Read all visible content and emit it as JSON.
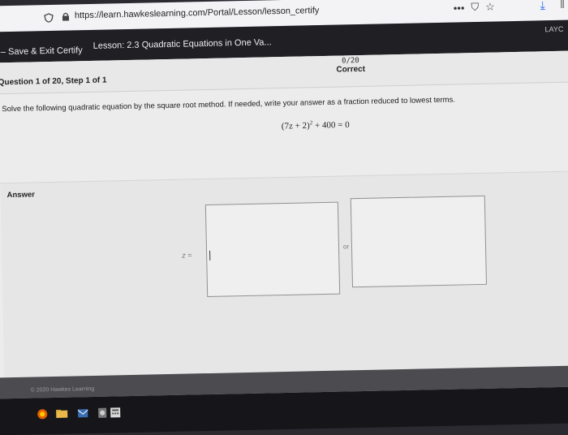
{
  "browser": {
    "url": "https://learn.hawkeslearning.com/Portal/Lesson/lesson_certify",
    "more_icon": "more-icon",
    "pocket_icon": "pocket-icon",
    "star_icon": "star-icon",
    "download_icon": "download-icon",
    "library_icon": "library-icon"
  },
  "lesson_bar": {
    "save_exit": "Save & Exit Certify",
    "lesson_title": "Lesson: 2.3 Quadratic Equations in One Va...",
    "layout_partial": "LAYC"
  },
  "question": {
    "step_label": "Question 1 of 20, Step 1 of 1",
    "score": "0/20",
    "status": "Correct",
    "instructions": "Solve the following quadratic equation by the square root method. If needed, write your answer as a fraction reduced to lowest terms.",
    "equation_left": "(7z + 2)",
    "equation_exp": "2",
    "equation_right": " + 400 = 0"
  },
  "answer": {
    "label": "Answer",
    "var_label": "z =",
    "separator": "or",
    "input_1_value": "",
    "input_2_value": ""
  },
  "footer": {
    "copyright": "© 2020 Hawkes Learning"
  },
  "colors": {
    "dark_bar": "#1f1f24",
    "content_bg": "#ececec",
    "download_blue": "#2a6ee6"
  }
}
